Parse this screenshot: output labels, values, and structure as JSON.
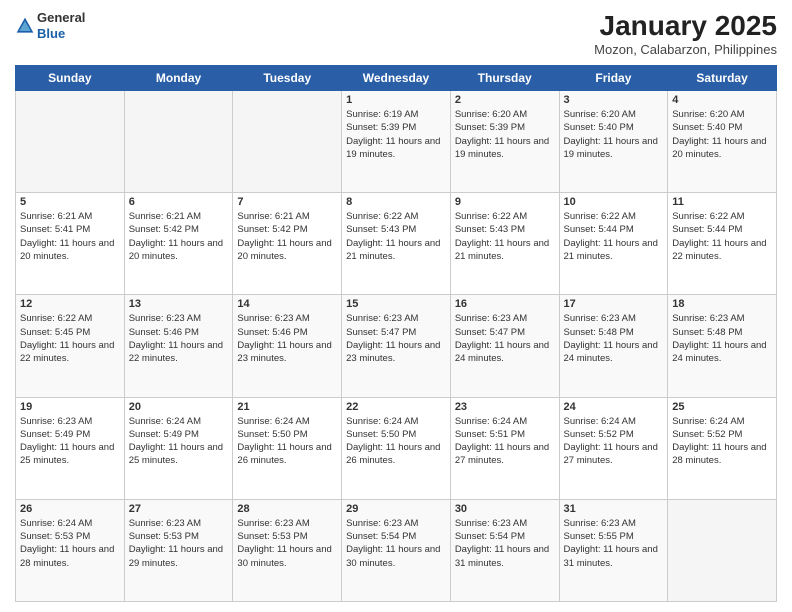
{
  "brand": {
    "name_general": "General",
    "name_blue": "Blue"
  },
  "header": {
    "title": "January 2025",
    "subtitle": "Mozon, Calabarzon, Philippines"
  },
  "days": [
    "Sunday",
    "Monday",
    "Tuesday",
    "Wednesday",
    "Thursday",
    "Friday",
    "Saturday"
  ],
  "weeks": [
    [
      {
        "day": "",
        "sunrise": "",
        "sunset": "",
        "daylight": ""
      },
      {
        "day": "",
        "sunrise": "",
        "sunset": "",
        "daylight": ""
      },
      {
        "day": "",
        "sunrise": "",
        "sunset": "",
        "daylight": ""
      },
      {
        "day": "1",
        "sunrise": "Sunrise: 6:19 AM",
        "sunset": "Sunset: 5:39 PM",
        "daylight": "Daylight: 11 hours and 19 minutes."
      },
      {
        "day": "2",
        "sunrise": "Sunrise: 6:20 AM",
        "sunset": "Sunset: 5:39 PM",
        "daylight": "Daylight: 11 hours and 19 minutes."
      },
      {
        "day": "3",
        "sunrise": "Sunrise: 6:20 AM",
        "sunset": "Sunset: 5:40 PM",
        "daylight": "Daylight: 11 hours and 19 minutes."
      },
      {
        "day": "4",
        "sunrise": "Sunrise: 6:20 AM",
        "sunset": "Sunset: 5:40 PM",
        "daylight": "Daylight: 11 hours and 20 minutes."
      }
    ],
    [
      {
        "day": "5",
        "sunrise": "Sunrise: 6:21 AM",
        "sunset": "Sunset: 5:41 PM",
        "daylight": "Daylight: 11 hours and 20 minutes."
      },
      {
        "day": "6",
        "sunrise": "Sunrise: 6:21 AM",
        "sunset": "Sunset: 5:42 PM",
        "daylight": "Daylight: 11 hours and 20 minutes."
      },
      {
        "day": "7",
        "sunrise": "Sunrise: 6:21 AM",
        "sunset": "Sunset: 5:42 PM",
        "daylight": "Daylight: 11 hours and 20 minutes."
      },
      {
        "day": "8",
        "sunrise": "Sunrise: 6:22 AM",
        "sunset": "Sunset: 5:43 PM",
        "daylight": "Daylight: 11 hours and 21 minutes."
      },
      {
        "day": "9",
        "sunrise": "Sunrise: 6:22 AM",
        "sunset": "Sunset: 5:43 PM",
        "daylight": "Daylight: 11 hours and 21 minutes."
      },
      {
        "day": "10",
        "sunrise": "Sunrise: 6:22 AM",
        "sunset": "Sunset: 5:44 PM",
        "daylight": "Daylight: 11 hours and 21 minutes."
      },
      {
        "day": "11",
        "sunrise": "Sunrise: 6:22 AM",
        "sunset": "Sunset: 5:44 PM",
        "daylight": "Daylight: 11 hours and 22 minutes."
      }
    ],
    [
      {
        "day": "12",
        "sunrise": "Sunrise: 6:22 AM",
        "sunset": "Sunset: 5:45 PM",
        "daylight": "Daylight: 11 hours and 22 minutes."
      },
      {
        "day": "13",
        "sunrise": "Sunrise: 6:23 AM",
        "sunset": "Sunset: 5:46 PM",
        "daylight": "Daylight: 11 hours and 22 minutes."
      },
      {
        "day": "14",
        "sunrise": "Sunrise: 6:23 AM",
        "sunset": "Sunset: 5:46 PM",
        "daylight": "Daylight: 11 hours and 23 minutes."
      },
      {
        "day": "15",
        "sunrise": "Sunrise: 6:23 AM",
        "sunset": "Sunset: 5:47 PM",
        "daylight": "Daylight: 11 hours and 23 minutes."
      },
      {
        "day": "16",
        "sunrise": "Sunrise: 6:23 AM",
        "sunset": "Sunset: 5:47 PM",
        "daylight": "Daylight: 11 hours and 24 minutes."
      },
      {
        "day": "17",
        "sunrise": "Sunrise: 6:23 AM",
        "sunset": "Sunset: 5:48 PM",
        "daylight": "Daylight: 11 hours and 24 minutes."
      },
      {
        "day": "18",
        "sunrise": "Sunrise: 6:23 AM",
        "sunset": "Sunset: 5:48 PM",
        "daylight": "Daylight: 11 hours and 24 minutes."
      }
    ],
    [
      {
        "day": "19",
        "sunrise": "Sunrise: 6:23 AM",
        "sunset": "Sunset: 5:49 PM",
        "daylight": "Daylight: 11 hours and 25 minutes."
      },
      {
        "day": "20",
        "sunrise": "Sunrise: 6:24 AM",
        "sunset": "Sunset: 5:49 PM",
        "daylight": "Daylight: 11 hours and 25 minutes."
      },
      {
        "day": "21",
        "sunrise": "Sunrise: 6:24 AM",
        "sunset": "Sunset: 5:50 PM",
        "daylight": "Daylight: 11 hours and 26 minutes."
      },
      {
        "day": "22",
        "sunrise": "Sunrise: 6:24 AM",
        "sunset": "Sunset: 5:50 PM",
        "daylight": "Daylight: 11 hours and 26 minutes."
      },
      {
        "day": "23",
        "sunrise": "Sunrise: 6:24 AM",
        "sunset": "Sunset: 5:51 PM",
        "daylight": "Daylight: 11 hours and 27 minutes."
      },
      {
        "day": "24",
        "sunrise": "Sunrise: 6:24 AM",
        "sunset": "Sunset: 5:52 PM",
        "daylight": "Daylight: 11 hours and 27 minutes."
      },
      {
        "day": "25",
        "sunrise": "Sunrise: 6:24 AM",
        "sunset": "Sunset: 5:52 PM",
        "daylight": "Daylight: 11 hours and 28 minutes."
      }
    ],
    [
      {
        "day": "26",
        "sunrise": "Sunrise: 6:24 AM",
        "sunset": "Sunset: 5:53 PM",
        "daylight": "Daylight: 11 hours and 28 minutes."
      },
      {
        "day": "27",
        "sunrise": "Sunrise: 6:23 AM",
        "sunset": "Sunset: 5:53 PM",
        "daylight": "Daylight: 11 hours and 29 minutes."
      },
      {
        "day": "28",
        "sunrise": "Sunrise: 6:23 AM",
        "sunset": "Sunset: 5:53 PM",
        "daylight": "Daylight: 11 hours and 30 minutes."
      },
      {
        "day": "29",
        "sunrise": "Sunrise: 6:23 AM",
        "sunset": "Sunset: 5:54 PM",
        "daylight": "Daylight: 11 hours and 30 minutes."
      },
      {
        "day": "30",
        "sunrise": "Sunrise: 6:23 AM",
        "sunset": "Sunset: 5:54 PM",
        "daylight": "Daylight: 11 hours and 31 minutes."
      },
      {
        "day": "31",
        "sunrise": "Sunrise: 6:23 AM",
        "sunset": "Sunset: 5:55 PM",
        "daylight": "Daylight: 11 hours and 31 minutes."
      },
      {
        "day": "",
        "sunrise": "",
        "sunset": "",
        "daylight": ""
      }
    ]
  ]
}
